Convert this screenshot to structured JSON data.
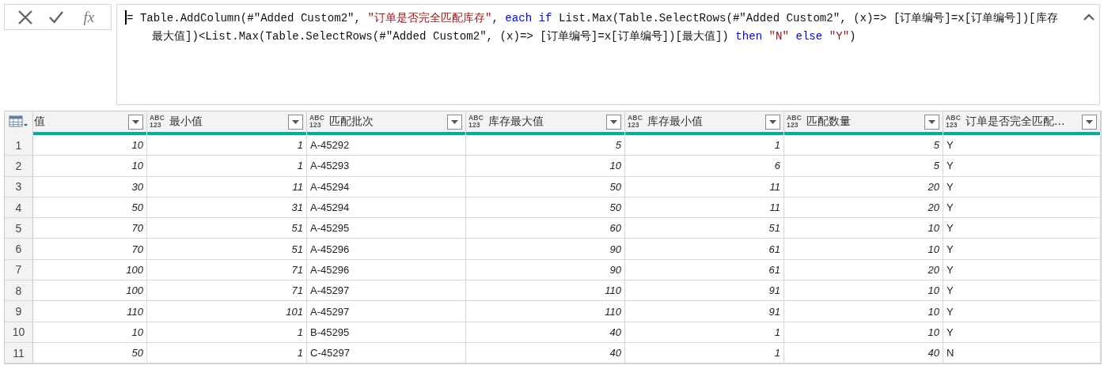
{
  "formula_bar": {
    "function_label": "fx",
    "formula": [
      {
        "kind": "code",
        "text": "= Table.AddColumn(#\"Added Custom2\", "
      },
      {
        "kind": "string",
        "text": "\"订单是否完全匹配库存\""
      },
      {
        "kind": "code",
        "text": ", "
      },
      {
        "kind": "keyword",
        "text": "each if"
      },
      {
        "kind": "code",
        "text": " List.Max(Table.SelectRows(#\"Added Custom2\", (x)=> [订单编号]=x[订单编号])[库存最大值])<List.Max(Table.SelectRows(#\"Added Custom2\", (x)=> [订单编号]=x[订单编号])[最大值]) "
      },
      {
        "kind": "keyword",
        "text": "then "
      },
      {
        "kind": "string",
        "text": "\"N\""
      },
      {
        "kind": "keyword",
        "text": " else "
      },
      {
        "kind": "string",
        "text": "\"Y\""
      },
      {
        "kind": "code",
        "text": ")"
      }
    ]
  },
  "table": {
    "columns": [
      {
        "label": "值",
        "kind": "number"
      },
      {
        "label": "最小值",
        "kind": "number",
        "type": [
          "ABC",
          "123"
        ]
      },
      {
        "label": "匹配批次",
        "kind": "text",
        "type": [
          "ABC",
          "123"
        ]
      },
      {
        "label": "库存最大值",
        "kind": "number",
        "type": [
          "ABC",
          "123"
        ]
      },
      {
        "label": "库存最小值",
        "kind": "number",
        "type": [
          "ABC",
          "123"
        ]
      },
      {
        "label": "匹配数量",
        "kind": "number",
        "type": [
          "ABC",
          "123"
        ]
      },
      {
        "label": "订单是否完全匹配...",
        "kind": "text",
        "type": [
          "ABC",
          "123"
        ]
      }
    ],
    "rows": [
      {
        "index": "1",
        "cells": [
          "10",
          "1",
          "A-45292",
          "5",
          "1",
          "5",
          "Y"
        ]
      },
      {
        "index": "2",
        "cells": [
          "10",
          "1",
          "A-45293",
          "10",
          "6",
          "5",
          "Y"
        ]
      },
      {
        "index": "3",
        "cells": [
          "30",
          "11",
          "A-45294",
          "50",
          "11",
          "20",
          "Y"
        ]
      },
      {
        "index": "4",
        "cells": [
          "50",
          "31",
          "A-45294",
          "50",
          "11",
          "20",
          "Y"
        ]
      },
      {
        "index": "5",
        "cells": [
          "70",
          "51",
          "A-45295",
          "60",
          "51",
          "10",
          "Y"
        ]
      },
      {
        "index": "6",
        "cells": [
          "70",
          "51",
          "A-45296",
          "90",
          "61",
          "10",
          "Y"
        ]
      },
      {
        "index": "7",
        "cells": [
          "100",
          "71",
          "A-45296",
          "90",
          "61",
          "20",
          "Y"
        ]
      },
      {
        "index": "8",
        "cells": [
          "100",
          "71",
          "A-45297",
          "110",
          "91",
          "10",
          "Y"
        ]
      },
      {
        "index": "9",
        "cells": [
          "110",
          "101",
          "A-45297",
          "110",
          "91",
          "10",
          "Y"
        ]
      },
      {
        "index": "10",
        "cells": [
          "10",
          "1",
          "B-45295",
          "40",
          "1",
          "10",
          "Y"
        ]
      },
      {
        "index": "11",
        "cells": [
          "50",
          "1",
          "C-45297",
          "40",
          "1",
          "40",
          "N"
        ]
      }
    ]
  }
}
